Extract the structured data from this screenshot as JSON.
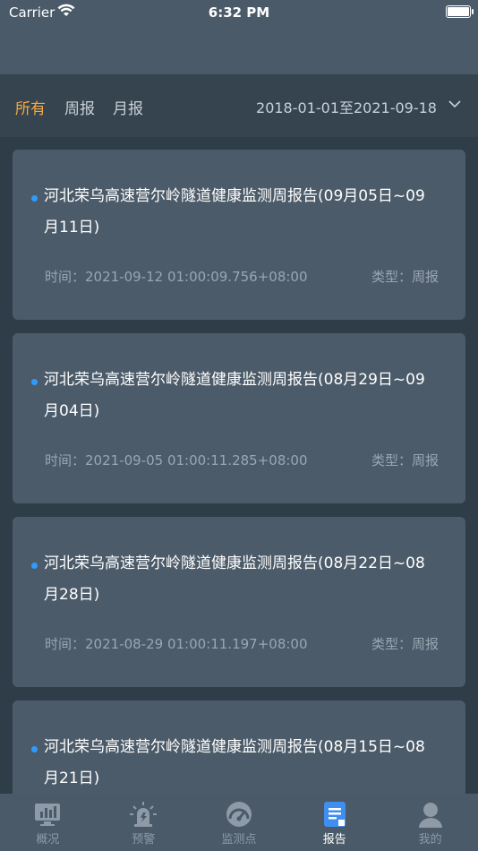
{
  "status": {
    "carrier": "Carrier",
    "time": "6:32 PM"
  },
  "filters": {
    "all": "所有",
    "weekly": "周报",
    "monthly": "月报",
    "date_range": "2018-01-01至2021-09-18"
  },
  "reports": [
    {
      "title": "河北荣乌高速营尔岭隧道健康监测周报告(09月05日~09月11日)",
      "time": "时间：2021-09-12 01:00:09.756+08:00",
      "type": "类型：周报"
    },
    {
      "title": "河北荣乌高速营尔岭隧道健康监测周报告(08月29日~09月04日)",
      "time": "时间：2021-09-05 01:00:11.285+08:00",
      "type": "类型：周报"
    },
    {
      "title": "河北荣乌高速营尔岭隧道健康监测周报告(08月22日~08月28日)",
      "time": "时间：2021-08-29 01:00:11.197+08:00",
      "type": "类型：周报"
    },
    {
      "title": "河北荣乌高速营尔岭隧道健康监测周报告(08月15日~08月21日)",
      "time": "",
      "type": ""
    }
  ],
  "tabs": [
    {
      "label": "概况",
      "icon": "chart-icon"
    },
    {
      "label": "预警",
      "icon": "alarm-icon"
    },
    {
      "label": "监测点",
      "icon": "gauge-icon"
    },
    {
      "label": "报告",
      "icon": "report-icon"
    },
    {
      "label": "我的",
      "icon": "user-icon"
    }
  ],
  "colors": {
    "accent": "#f5a742",
    "dot": "#2f9bff",
    "card": "#4c5b69",
    "bar": "#4a5a68"
  }
}
